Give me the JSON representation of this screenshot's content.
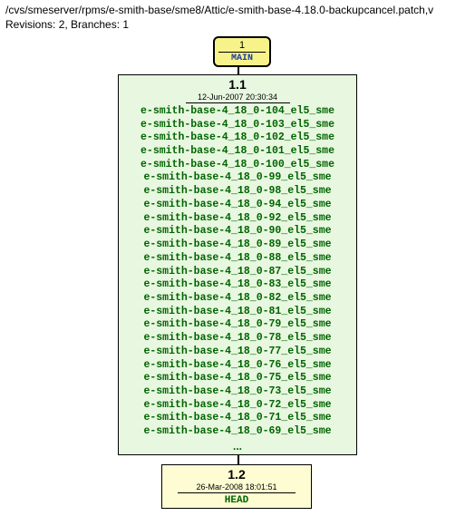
{
  "header": {
    "path": "/cvs/smeserver/rpms/e-smith-base/sme8/Attic/e-smith-base-4.18.0-backupcancel.patch,v",
    "meta": "Revisions: 2, Branches: 1"
  },
  "branch": {
    "number": "1",
    "name": "MAIN"
  },
  "rev1": {
    "number": "1.1",
    "date": "12-Jun-2007 20:30:34",
    "tags": [
      "e-smith-base-4_18_0-104_el5_sme",
      "e-smith-base-4_18_0-103_el5_sme",
      "e-smith-base-4_18_0-102_el5_sme",
      "e-smith-base-4_18_0-101_el5_sme",
      "e-smith-base-4_18_0-100_el5_sme",
      "e-smith-base-4_18_0-99_el5_sme",
      "e-smith-base-4_18_0-98_el5_sme",
      "e-smith-base-4_18_0-94_el5_sme",
      "e-smith-base-4_18_0-92_el5_sme",
      "e-smith-base-4_18_0-90_el5_sme",
      "e-smith-base-4_18_0-89_el5_sme",
      "e-smith-base-4_18_0-88_el5_sme",
      "e-smith-base-4_18_0-87_el5_sme",
      "e-smith-base-4_18_0-83_el5_sme",
      "e-smith-base-4_18_0-82_el5_sme",
      "e-smith-base-4_18_0-81_el5_sme",
      "e-smith-base-4_18_0-79_el5_sme",
      "e-smith-base-4_18_0-78_el5_sme",
      "e-smith-base-4_18_0-77_el5_sme",
      "e-smith-base-4_18_0-76_el5_sme",
      "e-smith-base-4_18_0-75_el5_sme",
      "e-smith-base-4_18_0-73_el5_sme",
      "e-smith-base-4_18_0-72_el5_sme",
      "e-smith-base-4_18_0-71_el5_sme",
      "e-smith-base-4_18_0-69_el5_sme"
    ],
    "ellipsis": "..."
  },
  "rev2": {
    "number": "1.2",
    "date": "26-Mar-2008 18:01:51",
    "head": "HEAD"
  }
}
